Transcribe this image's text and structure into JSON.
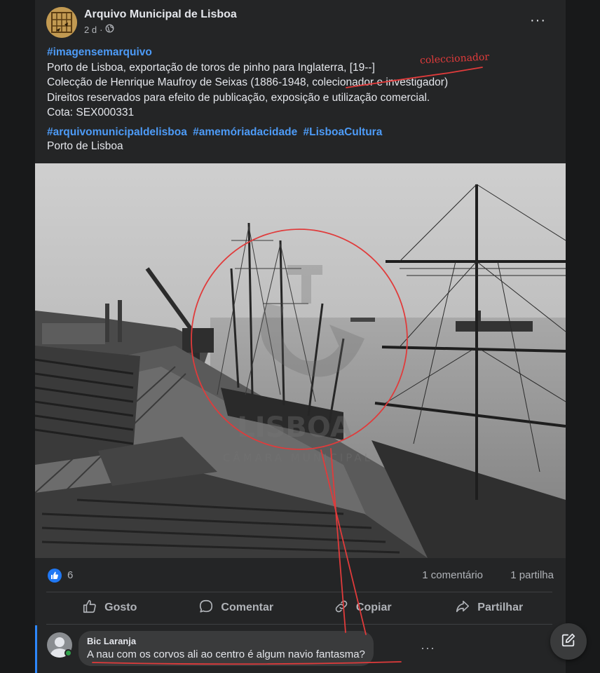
{
  "post": {
    "page_name": "Arquivo Municipal de Lisboa",
    "time": "2 d",
    "more": "···",
    "hashtag_top": "#imagensemarquivo",
    "caption_lines": [
      "Porto de Lisboa, exportação de toros de pinho para Inglaterra, [19--]",
      "Colecção de Henrique Maufroy de Seixas (1886-1948, colecionador e investigador)",
      "Direitos reservados para efeito de publicação, exposição e utilização comercial.",
      "Cota: SEX000331"
    ],
    "hashtags": [
      "#arquivomunicipaldelisboa",
      "#amemóriadacidade",
      "#LisboaCultura"
    ],
    "place": "Porto de Lisboa",
    "annotation": "coleccionador"
  },
  "photo": {
    "watermark": "CÂMARA MUNICIPAL"
  },
  "stats": {
    "likes": "6",
    "comments": "1 comentário",
    "shares": "1 partilha"
  },
  "actions": {
    "like": "Gosto",
    "comment": "Comentar",
    "copy": "Copiar",
    "share": "Partilhar"
  },
  "comment": {
    "author": "Bic Laranja",
    "text": "A nau com os corvos ali ao centro é algum navio fantasma?",
    "more": "···"
  },
  "colors": {
    "background": "#18191a",
    "card": "#242526",
    "hashtag": "#4d9bf7",
    "annotation_red": "#e03b3b",
    "like_blue": "#2078f4"
  }
}
